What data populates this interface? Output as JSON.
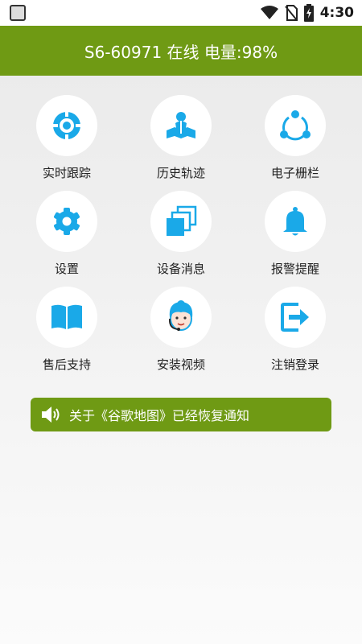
{
  "status_bar": {
    "time": "4:30"
  },
  "header": {
    "title": "S6-60971 在线 电量:98%"
  },
  "menu": [
    {
      "label": "实时跟踪",
      "icon": "target-icon"
    },
    {
      "label": "历史轨迹",
      "icon": "map-pin-icon"
    },
    {
      "label": "电子栅栏",
      "icon": "share-nodes-icon"
    },
    {
      "label": "设置",
      "icon": "gear-icon"
    },
    {
      "label": "设备消息",
      "icon": "stacked-pages-icon"
    },
    {
      "label": "报警提醒",
      "icon": "bell-icon"
    },
    {
      "label": "售后支持",
      "icon": "book-icon"
    },
    {
      "label": "安装视频",
      "icon": "support-agent-icon"
    },
    {
      "label": "注销登录",
      "icon": "logout-icon"
    }
  ],
  "notice": {
    "text": "关于《谷歌地图》已经恢复通知"
  },
  "colors": {
    "accent": "#6f9a14",
    "icon": "#1aa9e8"
  }
}
